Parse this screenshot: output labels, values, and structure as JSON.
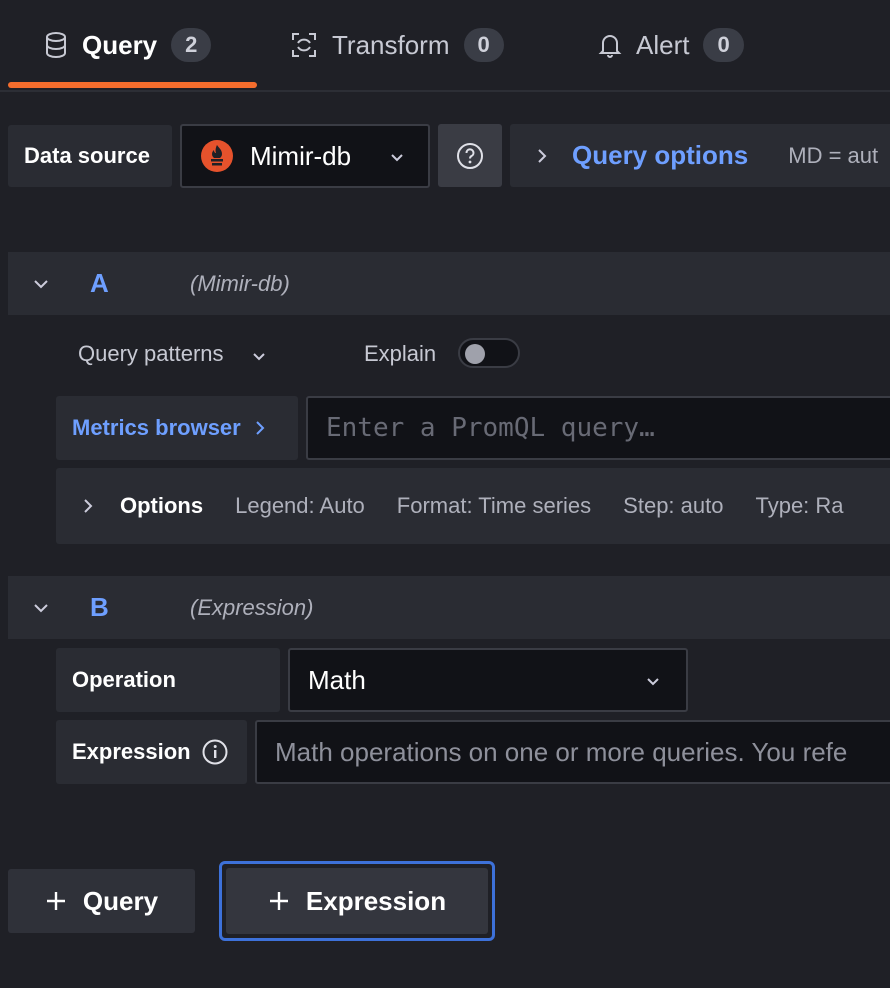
{
  "tabs": [
    {
      "label": "Query",
      "count": "2",
      "icon": "database-icon",
      "active": true
    },
    {
      "label": "Transform",
      "count": "0",
      "icon": "transform-icon",
      "active": false
    },
    {
      "label": "Alert",
      "count": "0",
      "icon": "bell-icon",
      "active": false
    }
  ],
  "toolbar": {
    "datasource_label": "Data source",
    "datasource_value": "Mimir-db",
    "query_options_label": "Query options",
    "query_options_summary": "MD = aut"
  },
  "query_a": {
    "ref": "A",
    "datasource": "(Mimir-db)",
    "query_patterns": "Query patterns",
    "explain": "Explain",
    "metrics_browser": "Metrics browser",
    "query_placeholder": "Enter a PromQL query…",
    "options_label": "Options",
    "legend": "Legend: Auto",
    "format": "Format: Time series",
    "step": "Step: auto",
    "type": "Type: Ra"
  },
  "query_b": {
    "ref": "B",
    "datasource": "(Expression)",
    "operation_label": "Operation",
    "operation_value": "Math",
    "expression_label": "Expression",
    "expression_placeholder": "Math operations on one or more queries. You refe"
  },
  "actions": {
    "add_query": "Query",
    "add_expression": "Expression"
  },
  "colors": {
    "accent_link": "#6e9fff",
    "tab_underline": "#f46d2d",
    "focus_border": "#3d71d9"
  }
}
